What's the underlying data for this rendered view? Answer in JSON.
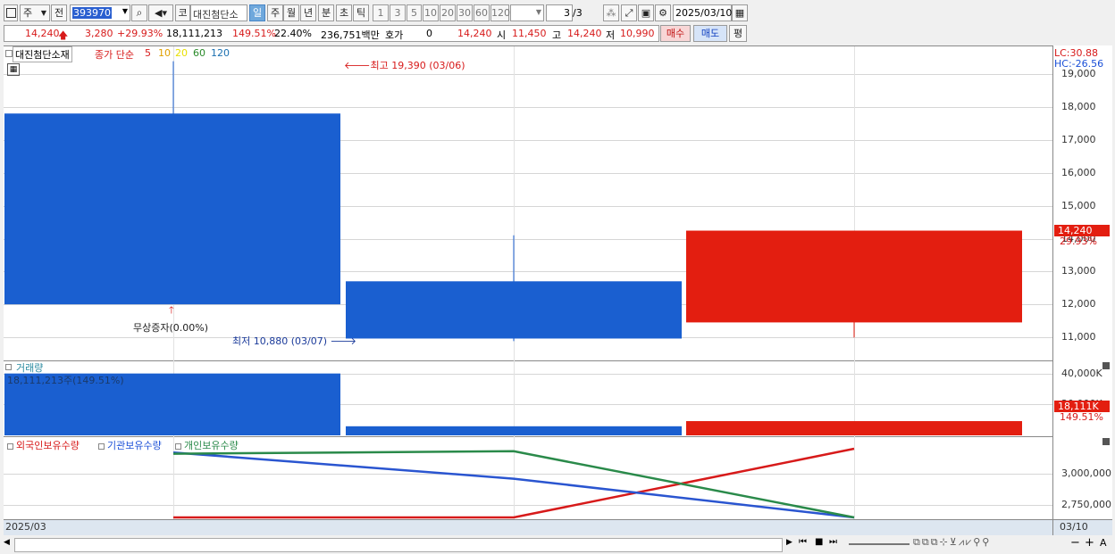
{
  "toolbar": {
    "period_type": "주",
    "prev_label": "전",
    "stock_code": "393970",
    "code_prefix": "코",
    "stock_name": "대진첨단소",
    "period_tabs": [
      {
        "label": "일",
        "selected": true
      },
      {
        "label": "주",
        "selected": false
      },
      {
        "label": "월",
        "selected": false
      },
      {
        "label": "년",
        "selected": false
      },
      {
        "label": "분",
        "selected": false
      },
      {
        "label": "초",
        "selected": false
      },
      {
        "label": "틱",
        "selected": false
      }
    ],
    "intervals": [
      "1",
      "3",
      "5",
      "10",
      "20",
      "30",
      "60",
      "120"
    ],
    "page_indicator": "3",
    "page_total": "/3",
    "date": "2025/03/10"
  },
  "quote": {
    "price": "14,240",
    "change": "3,280",
    "change_pct": "+29.93%",
    "volume": "18,111,213",
    "volume_pct": "149.51%",
    "turnover": "22.40%",
    "amount": "236,751백만",
    "hoga_label": "호가",
    "hoga_value": "0",
    "hoga_price": "14,240",
    "open_label": "시",
    "open": "11,450",
    "high_label": "고",
    "high": "14,240",
    "low_label": "저",
    "low": "10,990",
    "buy_label": "매수",
    "sell_label": "매도",
    "eval_label": "평"
  },
  "price_panel": {
    "name": "대진첨단소재",
    "indicator_label": "종가 단순",
    "ma_periods": [
      {
        "label": "5",
        "color": "#d71a1a"
      },
      {
        "label": "10",
        "color": "#e0a000"
      },
      {
        "label": "20",
        "color": "#e8e000"
      },
      {
        "label": "60",
        "color": "#2a8a2a"
      },
      {
        "label": "120",
        "color": "#1a6fb0"
      }
    ],
    "lc_label": "LC:30.88",
    "hc_label": "HC:-26.56",
    "high_annotation": "최고 19,390 (03/06)",
    "low_annotation": "최저 10,880 (03/07)",
    "event_annotation": "무상증자(0.00%)",
    "current_price_tag": "14,240",
    "current_pct_tag": "29.93%",
    "y_ticks": [
      "19,000",
      "18,000",
      "17,000",
      "16,000",
      "15,000",
      "14,000",
      "13,000",
      "12,000",
      "11,000"
    ]
  },
  "volume_panel": {
    "title": "거래량",
    "value_label": "18,111,213주(149.51%)",
    "tag_value": "18,111K",
    "tag_pct": "149.51%",
    "y_ticks": [
      "40,000K",
      "20,000K"
    ]
  },
  "holdings_panel": {
    "legend": [
      {
        "label": "외국인보유수량",
        "color": "#d71a1a"
      },
      {
        "label": "기관보유수량",
        "color": "#1a4fd7"
      },
      {
        "label": "개인보유수량",
        "color": "#2a8a4a"
      }
    ],
    "y_ticks": [
      "3,000,000",
      "2,750,000"
    ]
  },
  "footer": {
    "start_date": "2025/03",
    "end_date": "03/10"
  },
  "chart_data": {
    "type": "candlestick",
    "categories": [
      "03/06",
      "03/07",
      "03/10"
    ],
    "candles": [
      {
        "open": 17800,
        "high": 19390,
        "low": 12000,
        "close": 12000,
        "color": "#1a5fd0"
      },
      {
        "open": 12700,
        "high": 14100,
        "low": 10880,
        "close": 10960,
        "color": "#1a5fd0"
      },
      {
        "open": 11450,
        "high": 14240,
        "low": 10990,
        "close": 14240,
        "color": "#e31e10"
      }
    ],
    "ylim": [
      10700,
      19500
    ],
    "volume": {
      "values": [
        40200,
        5400,
        8800
      ],
      "colors": [
        "#1a5fd0",
        "#1a5fd0",
        "#e31e10"
      ],
      "ylim": [
        0,
        45000
      ]
    },
    "holdings": {
      "series": [
        {
          "name": "외국인보유수량",
          "color": "#d71a1a",
          "values": [
            2650000,
            2650000,
            3200000
          ]
        },
        {
          "name": "기관보유수량",
          "color": "#2a55d0",
          "values": [
            3170000,
            2960000,
            2650000
          ]
        },
        {
          "name": "개인보유수량",
          "color": "#2a8a4a",
          "values": [
            3160000,
            3180000,
            2650000
          ]
        }
      ],
      "ylim": [
        2600000,
        3300000
      ]
    }
  }
}
